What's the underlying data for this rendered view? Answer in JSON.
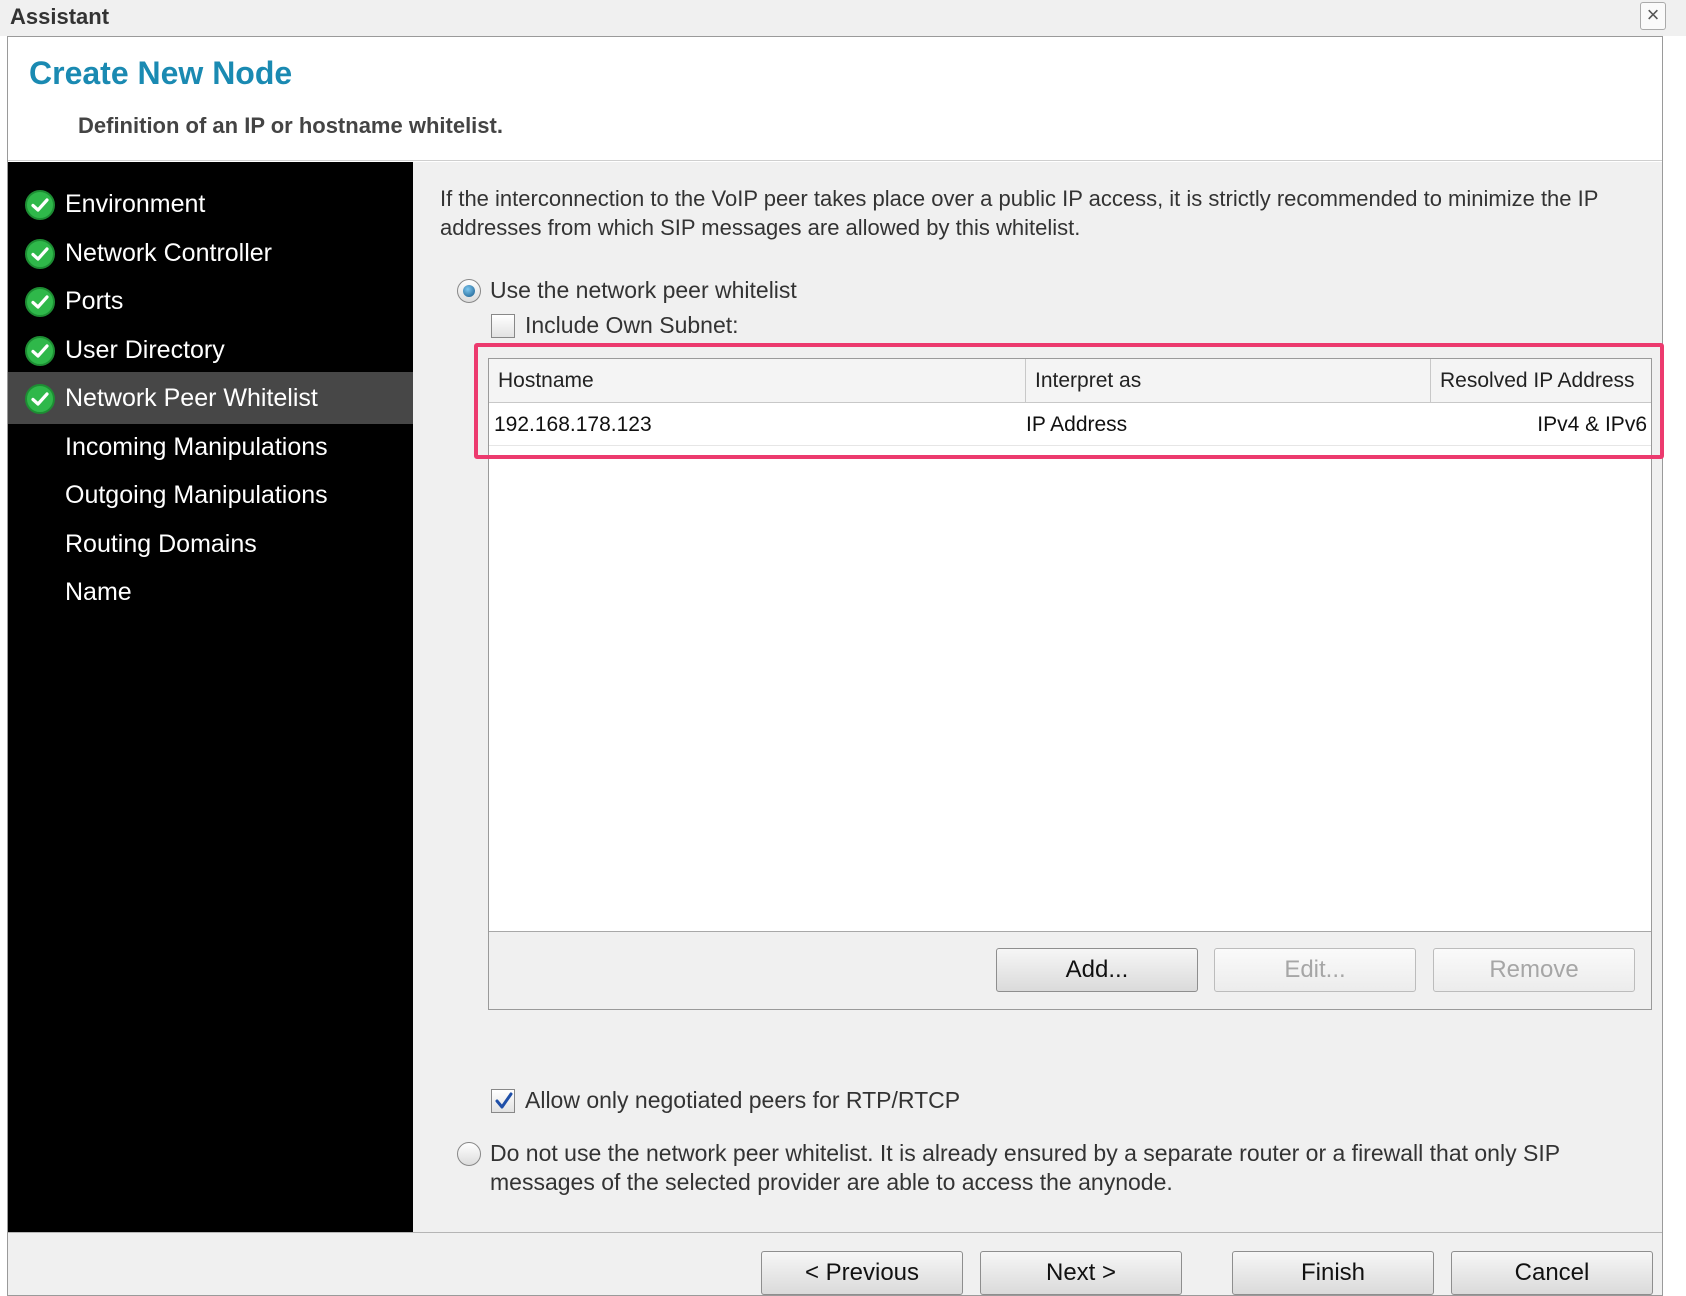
{
  "window": {
    "title": "Assistant",
    "close_glyph": "×"
  },
  "header": {
    "title": "Create New Node",
    "subtitle": "Definition of an IP or hostname whitelist."
  },
  "sidebar": {
    "steps": [
      {
        "label": "Environment",
        "done": true
      },
      {
        "label": "Network Controller",
        "done": true
      },
      {
        "label": "Ports",
        "done": true
      },
      {
        "label": "User Directory",
        "done": true
      },
      {
        "label": "Network Peer Whitelist",
        "done": true,
        "active": true
      },
      {
        "label": "Incoming Manipulations",
        "done": false
      },
      {
        "label": "Outgoing Manipulations",
        "done": false
      },
      {
        "label": "Routing Domains",
        "done": false
      },
      {
        "label": "Name",
        "done": false
      }
    ]
  },
  "main": {
    "intro": "If the interconnection to the VoIP peer takes place over a public IP access, it is strictly recommended to minimize the IP addresses from which SIP messages are allowed by this whitelist.",
    "option_use": {
      "label": "Use the network peer whitelist",
      "selected": true
    },
    "include_subnet": {
      "label": "Include Own Subnet:",
      "checked": false
    },
    "table": {
      "columns": [
        "Hostname",
        "Interpret as",
        "Resolved IP Address"
      ],
      "rows": [
        {
          "hostname": "192.168.178.123",
          "interpret_as": "IP Address",
          "resolved": "IPv4 & IPv6"
        }
      ]
    },
    "buttons": {
      "add": "Add...",
      "edit": "Edit...",
      "remove": "Remove"
    },
    "allow_negotiated": {
      "label": "Allow only negotiated peers for RTP/RTCP",
      "checked": true
    },
    "option_skip": {
      "label_line1": "Do not use the network peer whitelist. It is already ensured by a separate router or a firewall that only SIP",
      "label_line2": "messages of the selected provider are able to access the anynode.",
      "selected": false
    }
  },
  "footer": {
    "previous": "< Previous",
    "next": "Next >",
    "finish": "Finish",
    "cancel": "Cancel"
  },
  "colors": {
    "title_blue": "#1a8ab2",
    "check_green": "#2fb84a",
    "highlight": "#ec3a6e",
    "sidebar_bg": "#000000",
    "sidebar_active": "#474747"
  }
}
